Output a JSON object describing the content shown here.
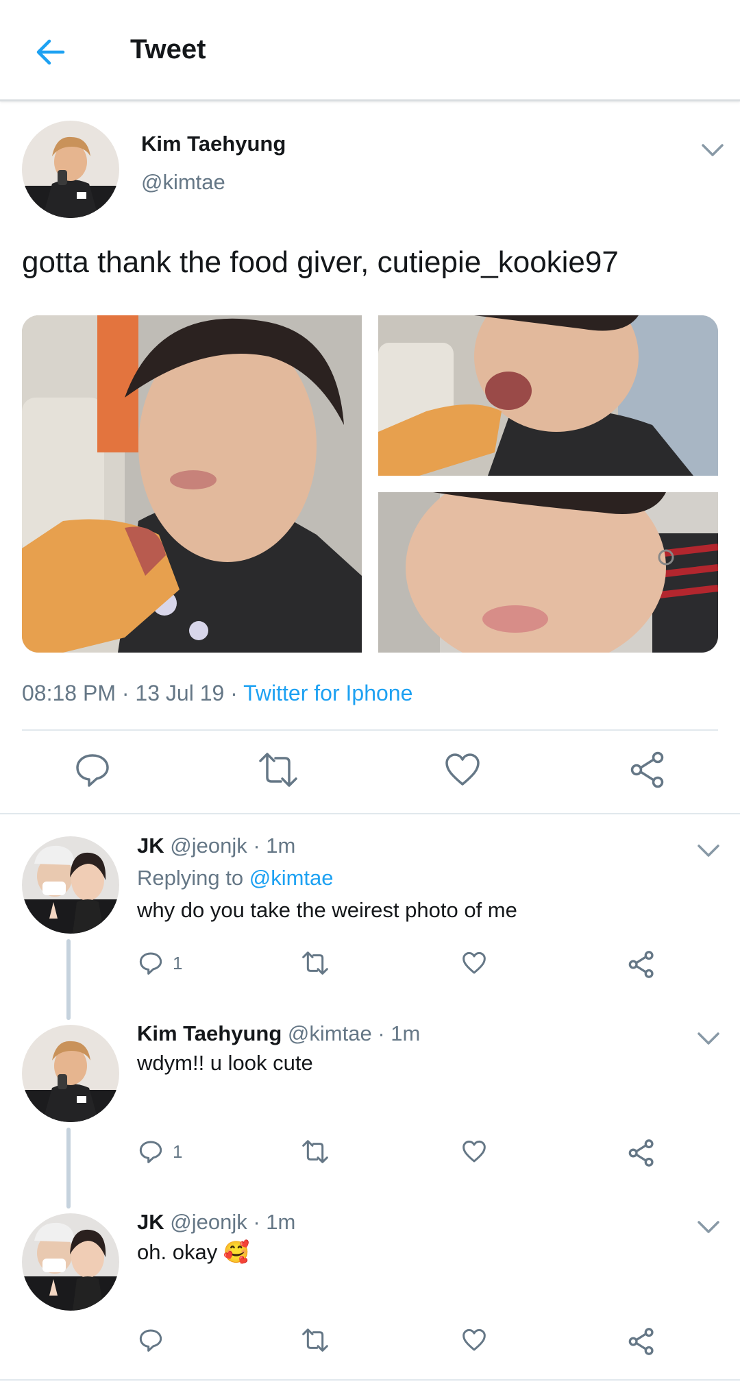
{
  "header": {
    "title": "Tweet",
    "back_icon": "arrow-left-icon"
  },
  "colors": {
    "accent": "#1da1f2",
    "text": "#14171a",
    "muted": "#657786",
    "divider": "#e1e8ed",
    "thread_line": "#c5d2dd"
  },
  "tweet": {
    "author_name": "Kim Taehyung",
    "author_handle": "@kimtae",
    "text": "gotta thank the food giver, cutiepie_kookie97",
    "media_count": 3,
    "time": "08:18 PM",
    "date": "13 Jul 19",
    "source": "Twitter for Iphone",
    "dot": " · "
  },
  "replies": [
    {
      "name": "JK",
      "handle": "@jeonjk",
      "time": "· 1m",
      "replying_prefix": "Replying to ",
      "replying_to": "@kimtae",
      "text": "why do you take the weirest photo of me",
      "reply_count": "1"
    },
    {
      "name": "Kim Taehyung",
      "handle": "@kimtae",
      "time": "· 1m",
      "text": "wdym!! u look cute",
      "reply_count": "1"
    },
    {
      "name": "JK",
      "handle": "@jeonjk",
      "time": "· 1m",
      "text": "oh. okay 🥰",
      "reply_count": ""
    }
  ]
}
